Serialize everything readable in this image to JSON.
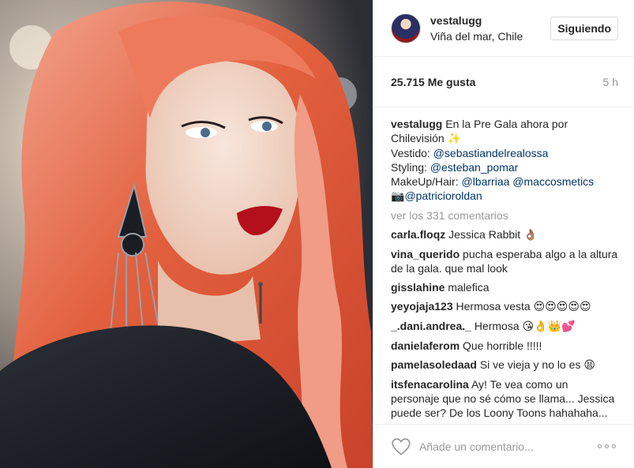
{
  "post": {
    "image_alt": "Portrait of woman with red wavy hair and large earrings",
    "username": "vestalugg",
    "location": "Viña del mar, Chile",
    "follow_label": "Siguiendo",
    "likes": "25.715 Me gusta",
    "time": "5 h",
    "caption": {
      "user": "vestalugg",
      "line1_text": "En la Pre Gala ahora por",
      "line2_text": "Chilevisión",
      "line2_emoji": "✨",
      "line3_label": "Vestido:",
      "line3_link": "@sebastiandelrealossa",
      "line4_label": "Styling:",
      "line4_link": "@esteban_pomar",
      "line5_label": "MakeUp/Hair:",
      "line5_link1": "@lbarriaa",
      "line5_link2": "@maccosmetics",
      "line6_emoji": "📷",
      "line6_link": "@patricioroldan"
    },
    "view_all": "ver los 331 comentarios",
    "comments": [
      {
        "user": "carla.floqz",
        "text": "Jessica Rabbit",
        "emoji": "👌🏽"
      },
      {
        "user": "vina_querido",
        "text": "pucha esperaba algo a la altura de la gala. que mal look",
        "emoji": ""
      },
      {
        "user": "gisslahine",
        "text": "malefica",
        "emoji": ""
      },
      {
        "user": "yeyojaja123",
        "text": "Hermosa vesta",
        "emoji": "😍😍😍😍😍"
      },
      {
        "user": "_.dani.andrea._",
        "text": "Hermosa",
        "emoji": "😘👌👑💕"
      },
      {
        "user": "danielaferom",
        "text": "Que horrible !!!!!",
        "emoji": ""
      },
      {
        "user": "pamelasoledaad",
        "text": "Si ve vieja y no lo es",
        "emoji": "😫"
      },
      {
        "user": "itsfenacarolina",
        "text": "Ay! Te vea como un personaje que no sé cómo se llama... Jessica puede ser? De los Loony Toons hahahaha... Como sea, R.E.G.I.A.!",
        "emoji": ""
      }
    ],
    "add_comment_placeholder": "Añade un comentario...",
    "icons": {
      "like": "heart-icon",
      "more": "more-options-icon"
    }
  }
}
